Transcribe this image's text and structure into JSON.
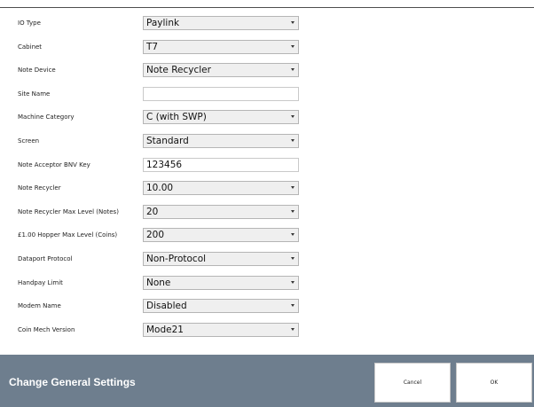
{
  "settings": [
    {
      "label": "IO Type",
      "type": "select",
      "value": "Paylink"
    },
    {
      "label": "Cabinet",
      "type": "select",
      "value": "T7"
    },
    {
      "label": "Note Device",
      "type": "select",
      "value": "Note Recycler"
    },
    {
      "label": "Site Name",
      "type": "text",
      "value": ""
    },
    {
      "label": "Machine Category",
      "type": "select",
      "value": "C (with SWP)"
    },
    {
      "label": "Screen",
      "type": "select",
      "value": "Standard"
    },
    {
      "label": "Note Acceptor BNV Key",
      "type": "text",
      "value": "123456"
    },
    {
      "label": "Note Recycler",
      "type": "select",
      "value": "10.00"
    },
    {
      "label": "Note Recycler Max Level (Notes)",
      "type": "select",
      "value": "20"
    },
    {
      "label": "£1.00 Hopper Max Level (Coins)",
      "type": "select",
      "value": "200"
    },
    {
      "label": "Dataport Protocol",
      "type": "select",
      "value": "Non-Protocol"
    },
    {
      "label": "Handpay Limit",
      "type": "select",
      "value": "None"
    },
    {
      "label": "Modem Name",
      "type": "select",
      "value": "Disabled"
    },
    {
      "label": "Coin Mech Version",
      "type": "select",
      "value": "Mode21"
    }
  ],
  "footer": {
    "title": "Change General Settings",
    "cancel_label": "Cancel",
    "ok_label": "OK"
  }
}
